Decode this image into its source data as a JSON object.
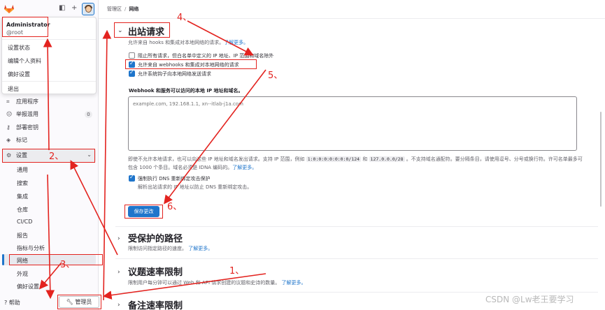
{
  "sidebar": {
    "dropdown": {
      "user_name": "Administrator",
      "user_handle": "@root",
      "items": [
        "设置状态",
        "编辑个人资料",
        "偏好设置"
      ],
      "signout": "退出"
    },
    "nav": [
      {
        "label": "应用程序",
        "icon": "apps-icon"
      },
      {
        "label": "举报滥用",
        "icon": "abuse-icon",
        "badge": "0"
      },
      {
        "label": "部署密钥",
        "icon": "key-icon"
      },
      {
        "label": "标记",
        "icon": "label-icon"
      }
    ],
    "settings": {
      "label": "设置",
      "icon": "gear-icon"
    },
    "settings_sub": [
      "通用",
      "搜索",
      "集成",
      "仓库",
      "CI/CD",
      "报告",
      "指标与分析",
      "网络",
      "外观",
      "偏好设置"
    ],
    "help_label": "帮助",
    "admin_label": "管理员"
  },
  "breadcrumb": {
    "parent": "管理区",
    "current": "网络"
  },
  "outbound": {
    "title": "出站请求",
    "desc": "允许来自 hooks 和集成对本地网络的请求。",
    "learn_more": "了解更多。",
    "checkboxes": [
      {
        "label": "阻止所有请求，但白名单中定义的 IP 地址、IP 范围和域名除外",
        "checked": false
      },
      {
        "label": "允许来自 webhooks 和集成对本地网络的请求",
        "checked": true
      },
      {
        "label": "允许系统钩子向本地网络发送请求",
        "checked": true
      }
    ],
    "allowlist_label": "Webhook 和服务可以访问的本地 IP 地址和域名。",
    "allowlist_placeholder": "example.com, 192.168.1.1, xn--itlab-j1a.com",
    "help_part1": "即使不允许本地请求，也可以向这些 IP 地址和域名发出请求。支持 IP 范围，例如",
    "help_code1": "1:0:0:0:0:0:0:0/124",
    "help_and": "和",
    "help_code2": "127.0.0.0/28",
    "help_part2": "。不支持域名通配符。要分隔条目，请使用逗号、分号或换行符。许可名单最多可包含 1000 个条目。域名必须是 IDNA 编码的。",
    "help_learn": "了解更多。",
    "dns_label": "强制执行 DNS 重新绑定攻击保护",
    "dns_help": "解析出站请求的 IP 地址以防止 DNS 重新绑定攻击。",
    "dns_checked": true,
    "save_label": "保存更改"
  },
  "protected_paths": {
    "title": "受保护的路径",
    "desc": "限制访问指定路径的速度。",
    "learn_more": "了解更多。"
  },
  "issues_rate": {
    "title": "议题速率限制",
    "desc": "限制用户每分钟可以通过 Web 和 API 请求创建的议题和史诗的数量。",
    "learn_more": "了解更多。"
  },
  "notes_rate": {
    "title": "备注速率限制"
  },
  "annotations": {
    "n1": "1、",
    "n2": "2、",
    "n3": "3、",
    "n4": "4、",
    "n5": "5、",
    "n6": "6、"
  },
  "watermark": "CSDN @Lw老王要学习",
  "colors": {
    "accent": "#1f75cb",
    "annotation": "#e3231f"
  }
}
